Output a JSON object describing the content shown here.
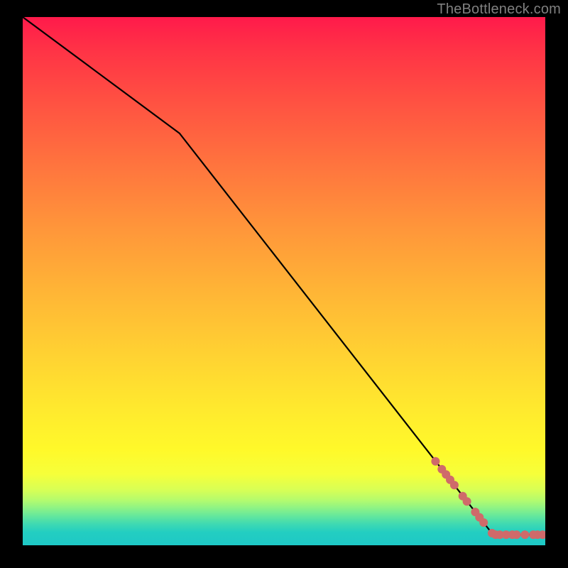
{
  "attribution": "TheBottleneck.com",
  "chart_data": {
    "type": "line",
    "title": "",
    "xlabel": "",
    "ylabel": "",
    "xlim": [
      0,
      100
    ],
    "ylim": [
      0,
      100
    ],
    "series": [
      {
        "name": "curve",
        "x": [
          0,
          30,
          90,
          100
        ],
        "y": [
          100,
          78,
          2,
          2
        ],
        "color": "#000000"
      }
    ],
    "markers": {
      "name": "highlighted-points",
      "color": "#cf6a6a",
      "radius_px": 6,
      "points": [
        {
          "x": 79.0,
          "y": 15.9
        },
        {
          "x": 80.2,
          "y": 14.4
        },
        {
          "x": 81.0,
          "y": 13.4
        },
        {
          "x": 81.8,
          "y": 12.4
        },
        {
          "x": 82.6,
          "y": 11.4
        },
        {
          "x": 84.2,
          "y": 9.3
        },
        {
          "x": 85.0,
          "y": 8.3
        },
        {
          "x": 86.6,
          "y": 6.3
        },
        {
          "x": 87.4,
          "y": 5.3
        },
        {
          "x": 88.2,
          "y": 4.3
        },
        {
          "x": 89.8,
          "y": 2.3
        },
        {
          "x": 90.5,
          "y": 2.0
        },
        {
          "x": 91.3,
          "y": 2.0
        },
        {
          "x": 92.5,
          "y": 2.0
        },
        {
          "x": 93.7,
          "y": 2.0
        },
        {
          "x": 94.5,
          "y": 2.0
        },
        {
          "x": 96.1,
          "y": 2.0
        },
        {
          "x": 97.7,
          "y": 2.0
        },
        {
          "x": 98.5,
          "y": 2.0
        },
        {
          "x": 99.5,
          "y": 2.0
        }
      ]
    },
    "background": {
      "type": "vertical-gradient",
      "stops": [
        {
          "pos": 0.0,
          "color": "#ff1a4b"
        },
        {
          "pos": 0.5,
          "color": "#ffb134"
        },
        {
          "pos": 0.82,
          "color": "#fff92a"
        },
        {
          "pos": 1.0,
          "color": "#1ec8c6"
        }
      ]
    }
  }
}
